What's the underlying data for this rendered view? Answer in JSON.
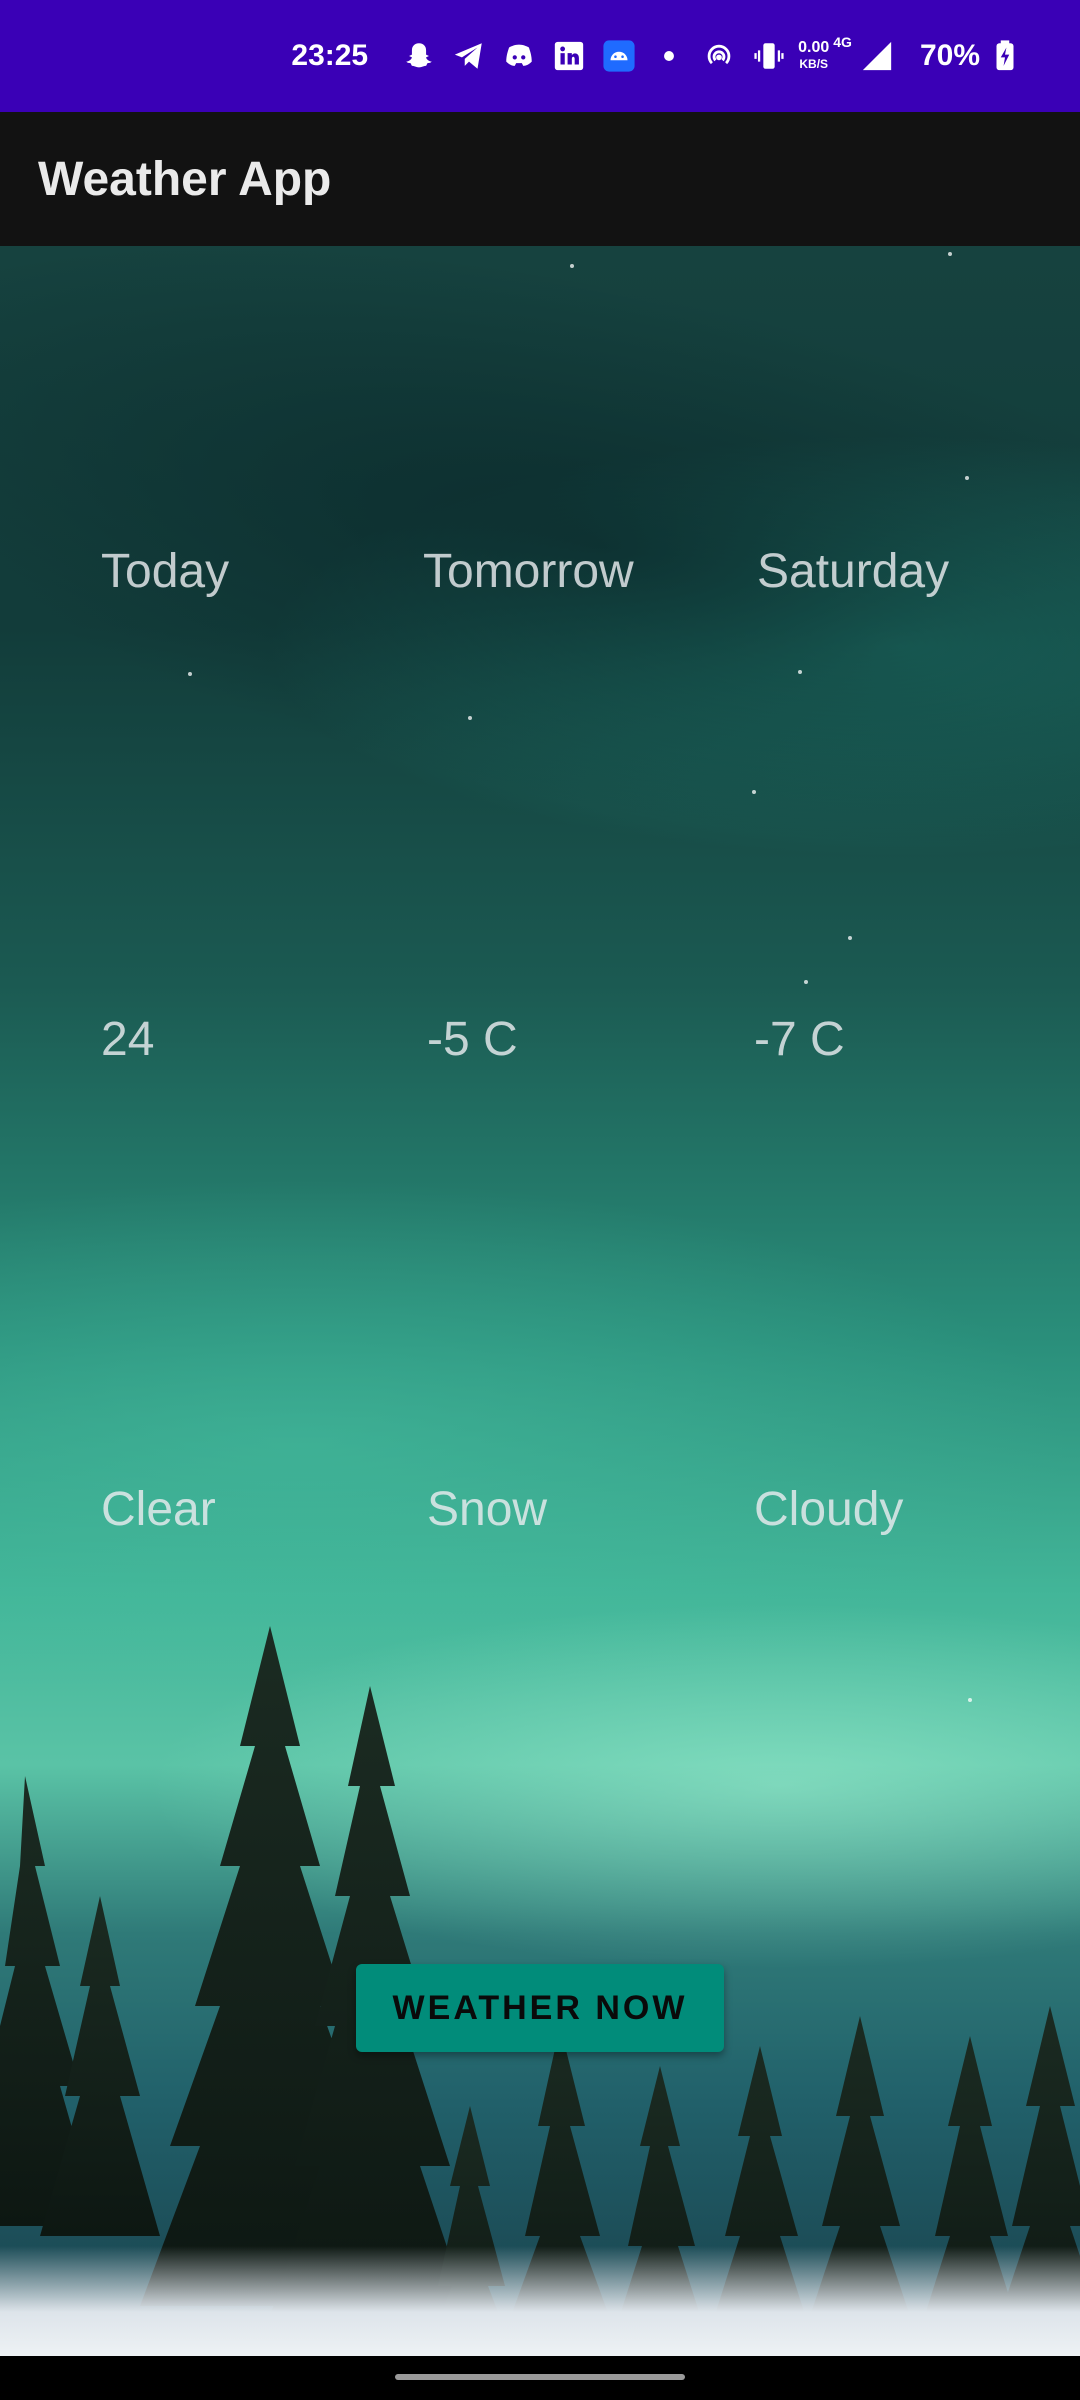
{
  "status_bar": {
    "time": "23:25",
    "net_speed_top": "0.00",
    "net_speed_bottom": "KB/S",
    "net_type": "4G",
    "battery": "70%"
  },
  "app_bar": {
    "title": "Weather App"
  },
  "forecast": {
    "days": [
      {
        "name": "Today",
        "temp": "24",
        "condition": "Clear"
      },
      {
        "name": "Tomorrow",
        "temp": "-5 C",
        "condition": "Snow"
      },
      {
        "name": "Saturday",
        "temp": "-7 C",
        "condition": "Cloudy"
      }
    ]
  },
  "button": {
    "label": "WEATHER NOW"
  },
  "colors": {
    "status_bar": "#3a00b6",
    "app_bar": "#121212",
    "button": "#018c7a"
  }
}
